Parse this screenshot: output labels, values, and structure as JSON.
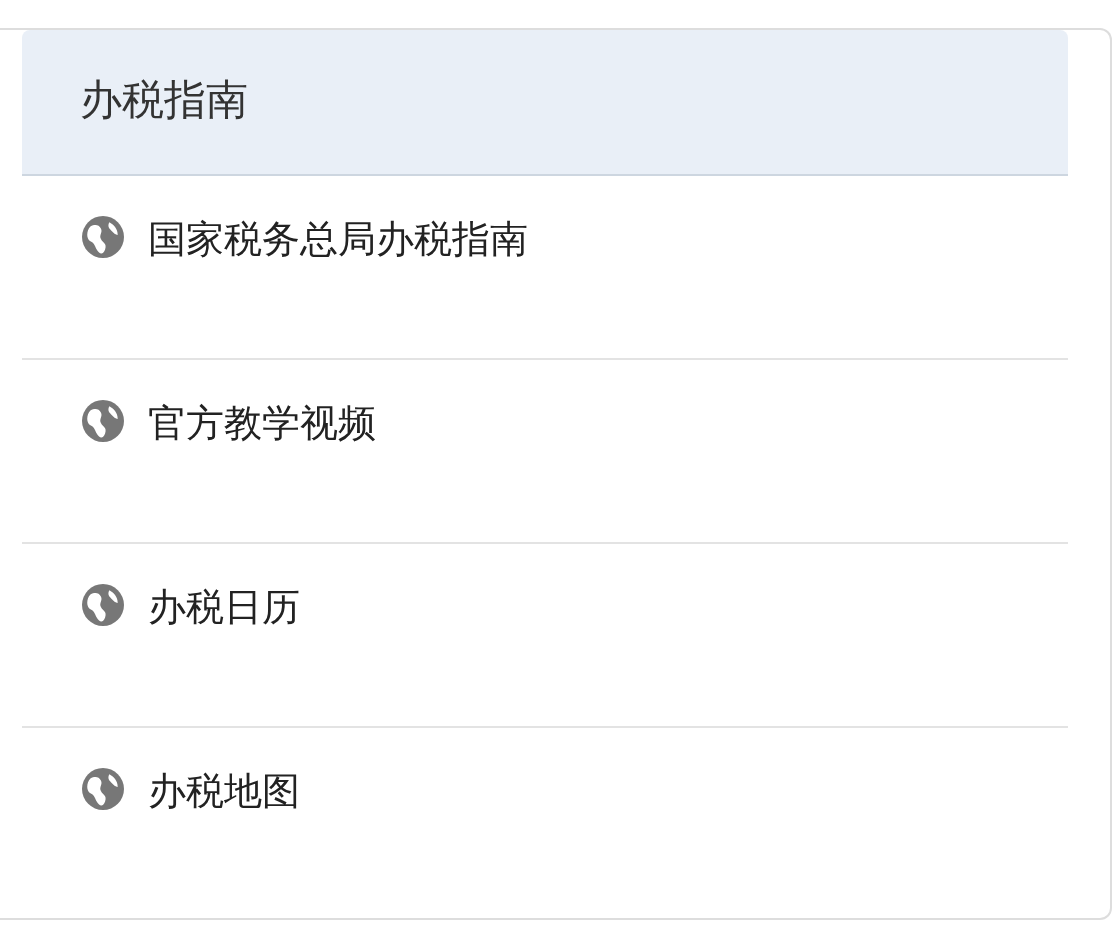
{
  "panel": {
    "title": "办税指南",
    "links": [
      {
        "label": "国家税务总局办税指南"
      },
      {
        "label": "官方教学视频"
      },
      {
        "label": "办税日历"
      },
      {
        "label": "办税地图"
      }
    ]
  }
}
